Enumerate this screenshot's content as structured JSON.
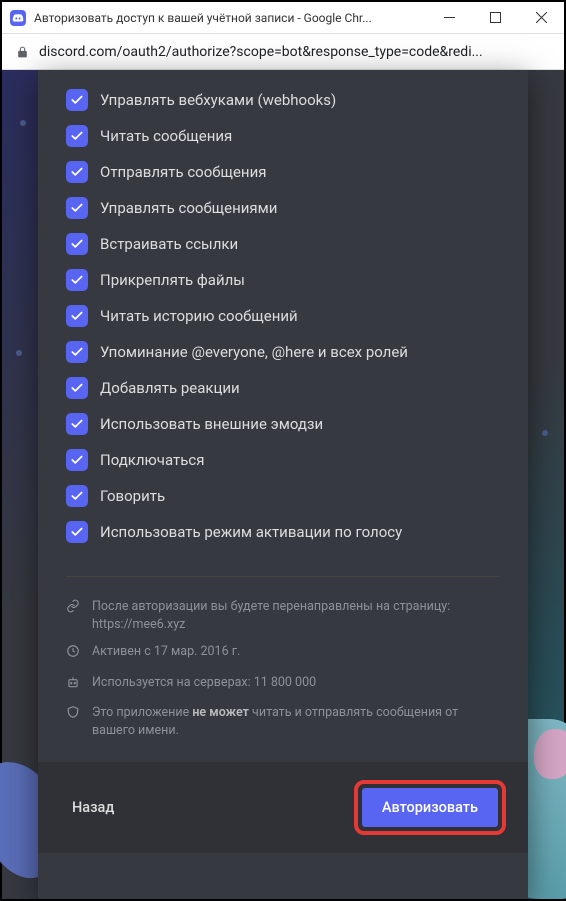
{
  "window": {
    "title": "Авторизовать доступ к вашей учётной записи - Google Chr..."
  },
  "address": {
    "url": "discord.com/oauth2/authorize?scope=bot&response_type=code&redi..."
  },
  "permissions": [
    {
      "label": "Управлять вебхуками (webhooks)"
    },
    {
      "label": "Читать сообщения"
    },
    {
      "label": "Отправлять сообщения"
    },
    {
      "label": "Управлять сообщениями"
    },
    {
      "label": "Встраивать ссылки"
    },
    {
      "label": "Прикреплять файлы"
    },
    {
      "label": "Читать историю сообщений"
    },
    {
      "label": "Упоминание @everyone, @here и всех ролей"
    },
    {
      "label": "Добавлять реакции"
    },
    {
      "label": "Использовать внешние эмодзи"
    },
    {
      "label": "Подключаться"
    },
    {
      "label": "Говорить"
    },
    {
      "label": "Использовать режим активации по голосу"
    }
  ],
  "info": {
    "redirect_line1": "После авторизации вы будете перенаправлены на страницу:",
    "redirect_line2": "https://mee6.xyz",
    "active_since": "Активен с 17 мар. 2016 г.",
    "servers": "Используется на серверах: 11 800 000",
    "disclaimer_pre": "Это приложение ",
    "disclaimer_bold": "не может",
    "disclaimer_post": " читать и отправлять сообщения от вашего имени."
  },
  "footer": {
    "back": "Назад",
    "authorize": "Авторизовать"
  }
}
